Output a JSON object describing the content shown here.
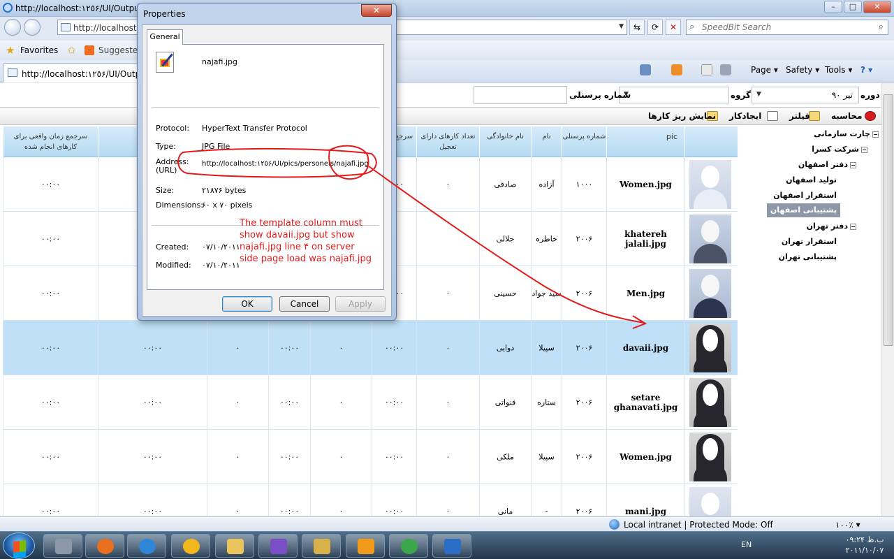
{
  "window": {
    "title": "http://localhost:١٢٥۶/UI/OutputS",
    "min": "–",
    "max": "□",
    "close": "✕"
  },
  "address_bar": {
    "url": "http://localhost:",
    "refresh": "⟳",
    "stop": "✕",
    "compat": "⇆"
  },
  "search": {
    "placeholder": "SpeedBit Search",
    "icon": "⌕",
    "go": "⌕"
  },
  "favorites_bar": {
    "favorites_label": "Favorites",
    "suggested": "Suggested"
  },
  "tabs": [
    {
      "label": "http://localhost:١٢٥۶/UI/Output"
    }
  ],
  "command_bar": {
    "page": "Page ▾",
    "safety": "Safety ▾",
    "tools": "Tools ▾",
    "help": "? ▾"
  },
  "filters": {
    "period_label": "دوره",
    "period_value": "تیر ۹۰",
    "group_label": "گروه",
    "personnel_label": "شماره پرسنلی"
  },
  "toolbar": {
    "calc": "محاسبه",
    "filter": "فیلتر",
    "create_job": "ایجادکار",
    "show_subtasks": "نمایش ریز کارها"
  },
  "grid": {
    "headers": {
      "pic": "pic",
      "personnel_no": "شماره پرسنلی",
      "first_name": "نام",
      "last_name": "نام خانوادگی",
      "urgent_count": "تعداد کارهای دارای تعجیل",
      "urgent_ref": "سرجع تعجیل",
      "done_for": "شده برای",
      "actual_ref": "سرجمع زمان واقعی برای کارهای انجام شده"
    },
    "rows": [
      {
        "pic": "Women.jpg",
        "no": "۱۰۰۰",
        "first": "آزاده",
        "last": "صادقی",
        "urgent": "۰",
        "ref": "۰۰:۰۰",
        "done": "",
        "actual": "۰۰:۰۰"
      },
      {
        "pic": "khatereh jalali.jpg",
        "no": "۲۰۰۶",
        "first": "خاطره",
        "last": "جلالی",
        "urgent": "",
        "ref": "",
        "done": "",
        "actual": "۰۰:۰۰"
      },
      {
        "pic": "Men.jpg",
        "no": "۲۰۰۶",
        "first": "سید جواد",
        "last": "حسینی",
        "urgent": "۰",
        "ref": "۰۰:۰۰",
        "done": "",
        "actual": "۰۰:۰۰"
      },
      {
        "pic": "davaii.jpg",
        "no": "۲۰۰۶",
        "first": "سپیلا",
        "last": "دوایی",
        "urgent": "۰",
        "ref": "۰۰:۰۰",
        "c3": "۰",
        "c4": "۰۰:۰۰",
        "c5": "۰",
        "done": "۰۰:۰۰",
        "actual": "۰۰:۰۰"
      },
      {
        "pic": "setare ghanavati.jpg",
        "no": "۲۰۰۶",
        "first": "ستاره",
        "last": "قنواتی",
        "urgent": "۰",
        "ref": "۰۰:۰۰",
        "c3": "۰",
        "c4": "۰۰:۰۰",
        "c5": "۰",
        "done": "۰۰:۰۰",
        "actual": "۰۰:۰۰"
      },
      {
        "pic": "Women.jpg",
        "no": "۲۰۰۶",
        "first": "سپیلا",
        "last": "ملکی",
        "urgent": "۰",
        "ref": "۰۰:۰۰",
        "c3": "۰",
        "c4": "۰۰:۰۰",
        "c5": "۰",
        "done": "۰۰:۰۰",
        "actual": "۰۰:۰۰"
      },
      {
        "pic": "mani.jpg",
        "no": "۲۰۰۶",
        "first": "-",
        "last": "مانی",
        "urgent": "۰",
        "ref": "۰۰:۰۰",
        "c3": "۰",
        "c4": "۰۰:۰۰",
        "c5": "۰",
        "done": "۰۰:۰۰",
        "actual": "۰۰:۰۰"
      }
    ]
  },
  "tree": {
    "items": [
      {
        "label": "چارت سازمانی",
        "exp": "−"
      },
      {
        "label": "شرکت کسرا",
        "exp": "−"
      },
      {
        "label": "دفتر اصفهان",
        "exp": "−"
      },
      {
        "label": "تولید اصفهان"
      },
      {
        "label": "استقرار اصفهان"
      },
      {
        "label": "پشتیبانی اصفهان"
      },
      {
        "label": "دفتر تهران",
        "exp": "−"
      },
      {
        "label": "استقرار تهران"
      },
      {
        "label": "پشتیبانی تهران"
      }
    ]
  },
  "status": {
    "zone": "Local intranet | Protected Mode: Off",
    "zoom": "۱۰۰٪ ▾"
  },
  "taskbar": {
    "lang": "EN",
    "time": "ب.ظ ۰۹:۲۴",
    "date": "۲۰۱۱/۱۰/۰۷"
  },
  "dialog": {
    "title": "Properties",
    "close": "✕",
    "tab": "General",
    "filename": "najafi.jpg",
    "protocol_label": "Protocol:",
    "protocol": "HyperText Transfer Protocol",
    "type_label": "Type:",
    "type": "JPG File",
    "address_label": "Address:",
    "address_label2": "(URL)",
    "address": "http://localhost:١٢٥۶/UI/pics/personels/najafi.jpg",
    "size_label": "Size:",
    "size": "۲۱۸۷۶ bytes",
    "dimensions_label": "Dimensions:",
    "dimensions": "۶۰ x ۷۰ pixels",
    "created_label": "Created:",
    "created": "۰۷/۱۰/۲۰۱۱",
    "modified_label": "Modified:",
    "modified": "۰۷/۱۰/۲۰۱۱",
    "annotation": "The template column must show davaii.jpg but show najafi.jpg line ۴ on server side page load was najafi.jpg",
    "ok": "OK",
    "cancel": "Cancel",
    "apply": "Apply"
  },
  "colors": {
    "grid_header": "#b4dbf3",
    "selected_row": "#bfe0f6",
    "annotation": "#e11b1b"
  }
}
